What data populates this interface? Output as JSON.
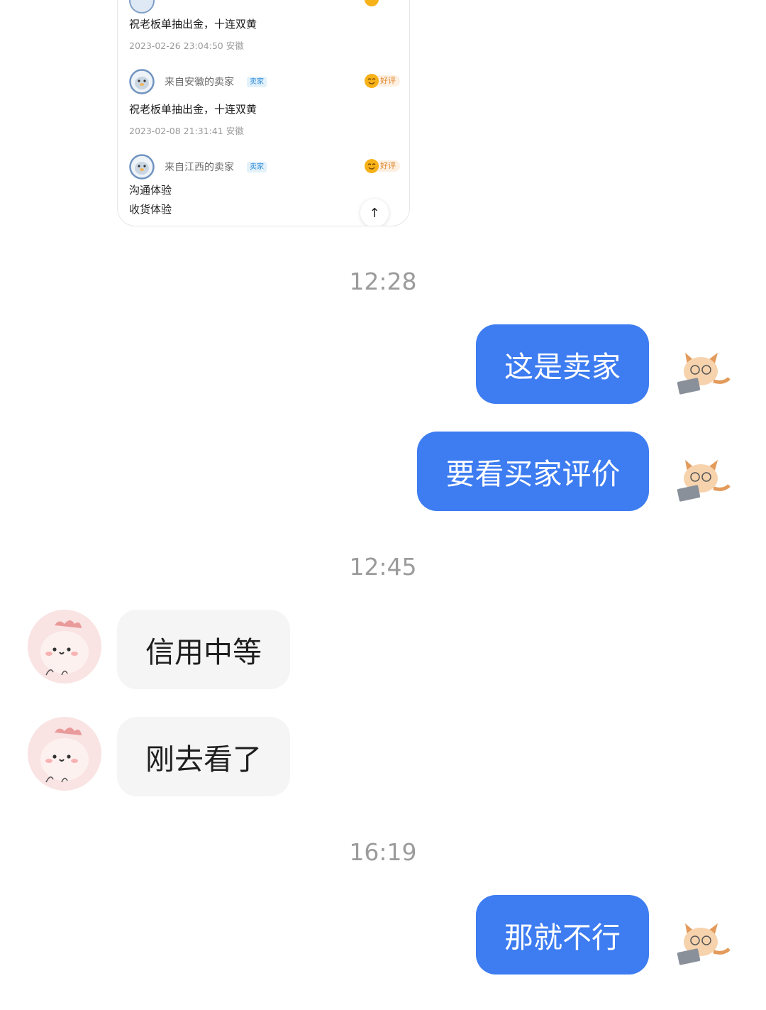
{
  "reviews": [
    {
      "text": "祝老板单抽出金，十连双黄",
      "date": "2023-02-26 23:04:50 安徽"
    },
    {
      "name": "来自安徽的卖家",
      "tag": "卖家",
      "badge": "好评",
      "text": "祝老板单抽出金，十连双黄",
      "date": "2023-02-08 21:31:41 安徽"
    },
    {
      "name": "来自江西的卖家",
      "tag": "卖家",
      "badge": "好评",
      "lines": [
        "沟通体验",
        "收货体验"
      ]
    }
  ],
  "scroll_top_icon": "arrow-up-icon",
  "timestamps": [
    "12:28",
    "12:45",
    "16:19"
  ],
  "messages": [
    {
      "side": "out",
      "text": "这是卖家"
    },
    {
      "side": "out",
      "text": "要看买家评价"
    },
    {
      "side": "in",
      "text": "信用中等"
    },
    {
      "side": "in",
      "text": "刚去看了"
    },
    {
      "side": "out",
      "text": "那就不行"
    }
  ],
  "colors": {
    "outgoing_bubble": "#3d7cf1",
    "incoming_bubble": "#f5f5f5",
    "timestamp": "#9b9b9b"
  }
}
